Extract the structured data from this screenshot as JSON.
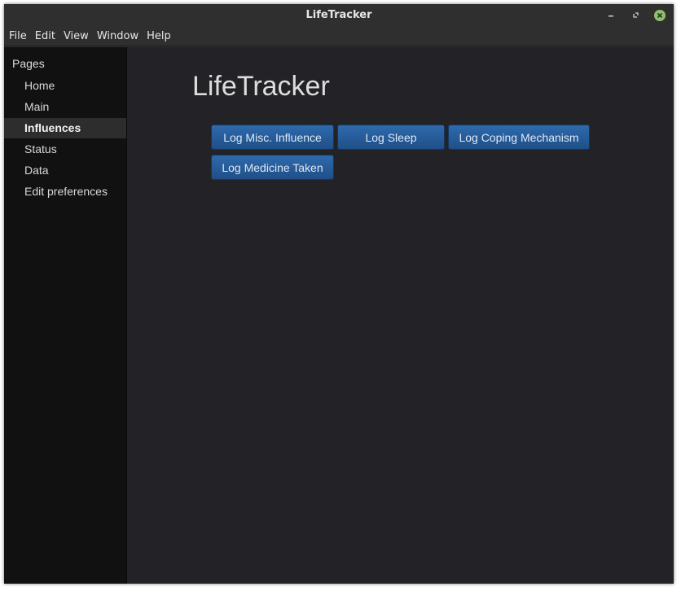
{
  "window": {
    "title": "LifeTracker",
    "controls": {
      "minimize": "minimize-icon",
      "maximize": "maximize-icon",
      "close": "close-icon"
    }
  },
  "menubar": {
    "items": [
      "File",
      "Edit",
      "View",
      "Window",
      "Help"
    ]
  },
  "sidebar": {
    "title": "Pages",
    "items": [
      {
        "label": "Home"
      },
      {
        "label": "Main"
      },
      {
        "label": "Influences",
        "active": true
      },
      {
        "label": "Status"
      },
      {
        "label": "Data"
      },
      {
        "label": "Edit preferences"
      }
    ]
  },
  "main": {
    "heading": "LifeTracker",
    "buttons": [
      {
        "label": "Log Misc. Influence"
      },
      {
        "label": "Log Sleep"
      },
      {
        "label": "Log Coping Mechanism"
      },
      {
        "label": "Log Medicine Taken"
      }
    ]
  },
  "colors": {
    "button": "#2a62a3",
    "close_button": "#8fbf6a",
    "sidebar_bg": "#111111",
    "main_bg": "#232226",
    "titlebar_bg": "#2f2f2f"
  }
}
